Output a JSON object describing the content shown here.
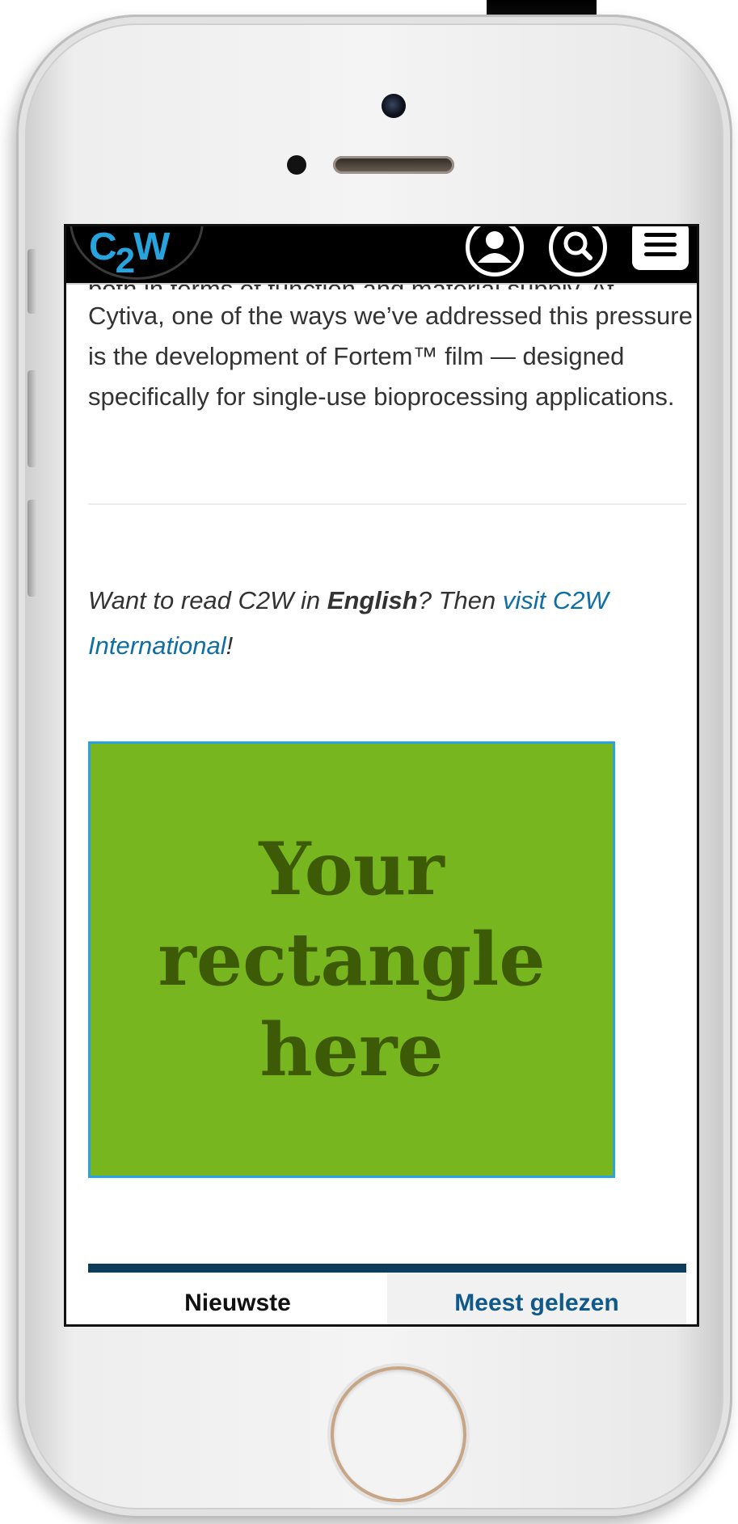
{
  "header": {
    "logo_text": "C2W",
    "user_icon": "user-icon",
    "search_icon": "search-icon",
    "menu_icon": "hamburger-menu-icon"
  },
  "article": {
    "partial_line": "both in terms of function and material supply. At",
    "paragraph": "Cytiva, one of the ways we’ve addressed this pressure is the development of Fortem™ film — designed specifically for single-use bioprocessing applications."
  },
  "promo": {
    "prefix": "Want to read C2W in ",
    "bold": "English",
    "middle": "? Then ",
    "link": "visit C2W International",
    "suffix": "!"
  },
  "ad": {
    "text": "Your rectangle here",
    "bg_color": "#78b61f",
    "text_color": "#3d5a07"
  },
  "tabs": {
    "newest": "Nieuwste",
    "most_read": "Meest gelezen"
  },
  "colors": {
    "accent": "#27a4dd",
    "link": "#0f6ea6",
    "tab_bar": "#0e3d5c"
  }
}
